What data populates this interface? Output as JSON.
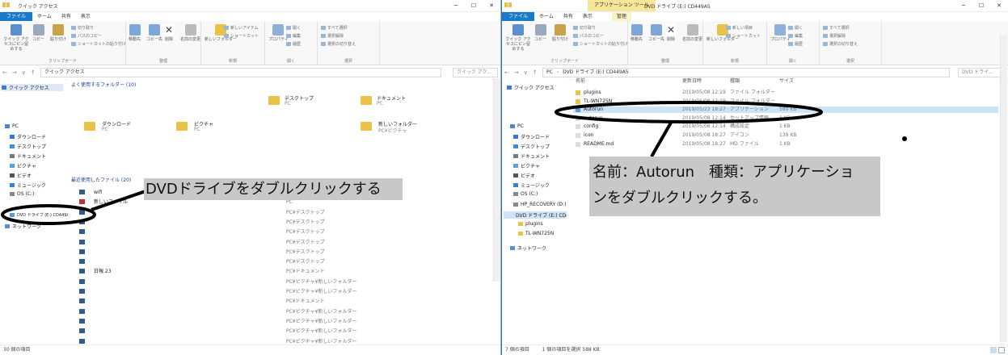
{
  "left_window": {
    "title": "クイック アクセス",
    "tabs": [
      "ファイル",
      "ホーム",
      "共有",
      "表示"
    ],
    "ribbon_groups": [
      "クリップボード",
      "整理",
      "新規",
      "開く",
      "選択"
    ],
    "ribbon_buttons": [
      "クイック アクセスにピン留めする",
      "コピー",
      "貼り付け",
      "切り取り",
      "パスのコピー",
      "ショートカットの貼り付け",
      "移動先",
      "コピー先",
      "削除",
      "名前の変更",
      "新しいフォルダー",
      "新しいアイテム",
      "ショートカット",
      "プロパティ",
      "開く",
      "編集",
      "履歴",
      "すべて選択",
      "選択解除",
      "選択の切り替え"
    ],
    "address": "クイック アクセス",
    "search_placeholder": "クイック アク...",
    "nav": [
      "クイック アクセス",
      "PC",
      "ダウンロード",
      "デスクトップ",
      "ドキュメント",
      "ピクチャ",
      "ビデオ",
      "ミュージック",
      "OS (C:)",
      "DVD ドライブ (E:) CD449A5",
      "ネットワーク"
    ],
    "frequent_header": "よく使用するフォルダー (10)",
    "frequent": [
      {
        "name": "デスクトップ",
        "sub": "PC"
      },
      {
        "name": "ドキュメント",
        "sub": "PC"
      },
      {
        "name": "ダウンロード",
        "sub": "PC"
      },
      {
        "name": "ピクチャ",
        "sub": "PC"
      },
      {
        "name": "新しいフォルダー",
        "sub": "PC¥ピクチャ"
      }
    ],
    "recent_header": "最近使用したファイル (20)",
    "recent": [
      {
        "name": "wifi",
        "loc": ""
      },
      {
        "name": "新しいファイル",
        "loc": "PC"
      },
      {
        "name": "",
        "loc": "PC¥デスクトップ"
      },
      {
        "name": "",
        "loc": "PC¥デスクトップ"
      },
      {
        "name": "",
        "loc": "PC¥デスクトップ"
      },
      {
        "name": "",
        "loc": "PC¥デスクトップ"
      },
      {
        "name": "",
        "loc": "PC¥デスクトップ"
      },
      {
        "name": "",
        "loc": "PC¥デスクトップ"
      },
      {
        "name": "日報 23",
        "loc": "PC¥ドキュメント"
      },
      {
        "name": "",
        "loc": "PC¥ピクチャ¥新しいフォルダー"
      },
      {
        "name": "",
        "loc": "PC¥ピクチャ¥新しいフォルダー"
      },
      {
        "name": "",
        "loc": "PC¥ドキュメント"
      },
      {
        "name": "",
        "loc": "PC¥ピクチャ¥新しいフォルダー"
      },
      {
        "name": "",
        "loc": "PC¥ピクチャ¥新しいフォルダー"
      },
      {
        "name": "",
        "loc": "PC¥ピクチャ¥新しいフォルダー"
      },
      {
        "name": "",
        "loc": "PC¥ピクチャ¥新しいフォルダー"
      }
    ],
    "status": "30 個の項目"
  },
  "right_window": {
    "context_tab": "アプリケーション ツール",
    "title": "DVD ドライブ (E:) CD449A5",
    "tabs": [
      "ファイル",
      "ホーム",
      "共有",
      "表示",
      "管理"
    ],
    "ribbon_groups": [
      "クリップボード",
      "整理",
      "新規",
      "開く",
      "選択"
    ],
    "ribbon_buttons": [
      "クイック アクセスにピン留めする",
      "コピー",
      "貼り付け",
      "切り取り",
      "パスのコピー",
      "ショートカットの貼り付け",
      "移動先",
      "コピー先",
      "削除",
      "名前の変更",
      "新しいフォルダー",
      "新しい項目",
      "ショートカット",
      "プロパティ",
      "開く",
      "編集",
      "履歴",
      "すべて選択",
      "選択解除",
      "選択の切り替え"
    ],
    "breadcrumb": [
      "PC",
      "DVD ドライブ (E:) CD449A5"
    ],
    "search_placeholder": "DVD ドライ...",
    "columns": [
      "名前",
      "更新日時",
      "種類",
      "サイズ"
    ],
    "files": [
      {
        "name": "plugins",
        "date": "2019/05/08 12:19",
        "type": "ファイル フォルダー",
        "size": ""
      },
      {
        "name": "TL-WN725N",
        "date": "2019/05/08 12:19",
        "type": "ファイル フォルダー",
        "size": ""
      },
      {
        "name": "Autorun",
        "date": "2019/05/23 18:27",
        "type": "アプリケーション",
        "size": "589 KB"
      },
      {
        "name": "autorun",
        "date": "2019/05/08 12:14",
        "type": "セットアップ情報",
        "size": "1 KB"
      },
      {
        "name": "config",
        "date": "2019/05/08 12:14",
        "type": "構成設定",
        "size": "1 KB"
      },
      {
        "name": "icon",
        "date": "2019/05/08 18:27",
        "type": "アイコン",
        "size": "139 KB"
      },
      {
        "name": "README.md",
        "date": "2019/05/08 18:27",
        "type": "MD ファイル",
        "size": "1 KB"
      }
    ],
    "nav": [
      "PC",
      "ダウンロード",
      "デスクトップ",
      "ドキュメント",
      "ピクチャ",
      "ビデオ",
      "ミュージック",
      "OS (C:)",
      "HP_RECOVERY (D:)",
      "DVD ドライブ (E:) CD449A5",
      "plugins",
      "TL-WN725N",
      "ネットワーク"
    ],
    "quick_access": "クイック アクセス",
    "status_count": "7 個の項目",
    "status_selected": "1 個の項目を選択 588 KB"
  },
  "annotations": {
    "left": "DVDドライブをダブルクリックする",
    "right_line1": "名前：Autorun　種類：アプリケーショ",
    "right_line2": "ンをダブルクリックする。"
  }
}
